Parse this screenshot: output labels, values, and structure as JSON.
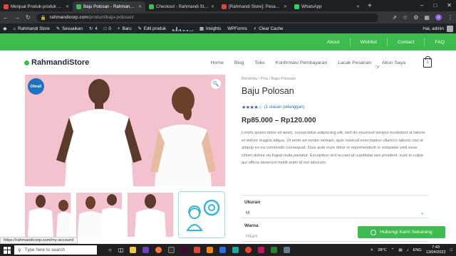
{
  "browser": {
    "tabs": [
      {
        "title": "Menjual Produk-produk Terb",
        "color": "#e0443e",
        "active": false
      },
      {
        "title": "Baju Polosan - Rahmandi Sto",
        "color": "#3dbb4e",
        "active": true
      },
      {
        "title": "Checkout - Rahmandi Store",
        "color": "#3dbb4e",
        "active": false
      },
      {
        "title": "[Rahmandi Store]: Pesanan b",
        "color": "#e0443e",
        "active": false
      },
      {
        "title": "WhatsApp",
        "color": "#25d366",
        "active": false
      }
    ],
    "new_tab": "+",
    "url_domain": "rahmandicorp.com",
    "url_path": "/product/baju-polosan/",
    "profile_initial": "d"
  },
  "wp_admin_bar": {
    "site": "Rahmandi Store",
    "customize": "Sesuaikan",
    "updates": "4",
    "comments": "0",
    "new": "Baru",
    "edit": "Edit produk",
    "insights": "Insights",
    "wpforms": "WPForms",
    "cache": "Clear Cache",
    "greeting": "Hai, admin"
  },
  "topnav": [
    "About",
    "Wishlist",
    "Contact",
    "FAQ"
  ],
  "header": {
    "logo": "RahmandiStore",
    "menu": [
      "Home",
      "Blog",
      "Toko",
      "Konfirmasi Pembayaran",
      "Lacak Pesanan",
      "Akun Saya"
    ],
    "cart_count": "1"
  },
  "product": {
    "badge": "Obral!",
    "breadcrumb": "Beranda / Pria / Baju Polosan",
    "title": "Baju Polosan",
    "rating": 4,
    "reviews": "(1 ulasan pelanggan)",
    "price": "Rp85.000 – Rp120.000",
    "description": "Lorem ipsum dolor sit amet, consectetur adipiscing elit, sed do eiusmod tempor incididunt ut labore et dolore magna aliqua. Ut enim ad minim veniam, quis nostrud exercitation ullamco laboris nisi ut aliquip ex ea commodo consequat. Duis aute irure dolor in reprehenderit in voluptate velit esse cillum dolore eu fugiat nulla pariatur. Excepteur sint occaecat cupidatat non proident, sunt in culpa qui officia deserunt mollit anim id est laborum.",
    "size_label": "Ukuran",
    "size_value": "M",
    "color_label": "Warna",
    "color_value": "Hitam"
  },
  "whatsapp_button": "Hubungi Kami Sekarang",
  "status_url": "https://rahmandicorp.com/my-account/",
  "taskbar": {
    "search_placeholder": "Type here to search",
    "weather": "28°C",
    "lang": "ENG",
    "time": "7:43",
    "date": "13/04/2022"
  },
  "colors": {
    "brand_green": "#3dbb4e",
    "wp_bar": "#1d2327",
    "badge_blue": "#1e73be",
    "image_pink": "#f4c1cf"
  }
}
